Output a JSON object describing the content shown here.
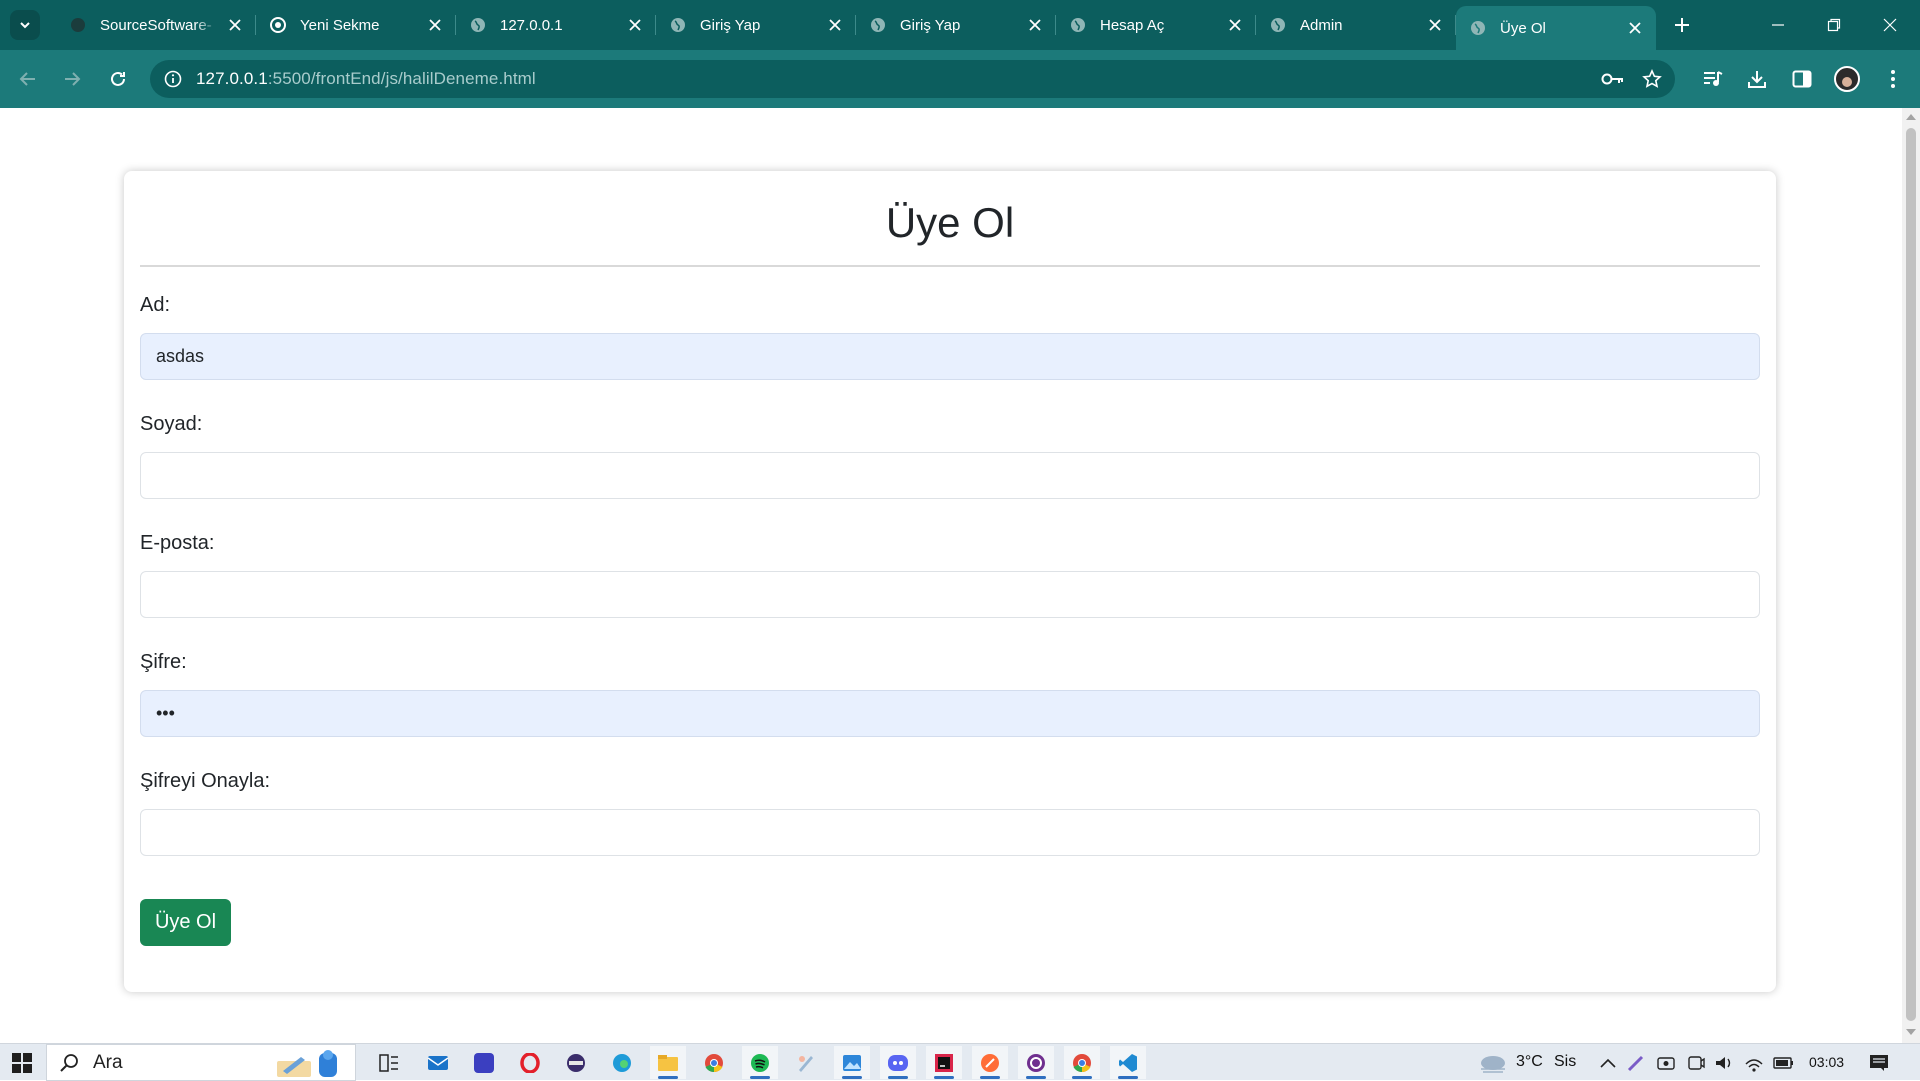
{
  "browser": {
    "tabs": [
      {
        "title": "SourceSoftware-",
        "favicon": "dark-circle-icon",
        "active": false
      },
      {
        "title": "Yeni Sekme",
        "favicon": "chrome-icon",
        "active": false
      },
      {
        "title": "127.0.0.1",
        "favicon": "globe-icon",
        "active": false
      },
      {
        "title": "Giriş Yap",
        "favicon": "globe-icon",
        "active": false
      },
      {
        "title": "Giriş Yap",
        "favicon": "globe-icon",
        "active": false
      },
      {
        "title": "Hesap Aç",
        "favicon": "globe-icon",
        "active": false
      },
      {
        "title": "Admin",
        "favicon": "globe-icon",
        "active": false
      },
      {
        "title": "Üye Ol",
        "favicon": "globe-icon",
        "active": true
      }
    ],
    "url": {
      "host": "127.0.0.1",
      "path": ":5500/frontEnd/js/halilDeneme.html"
    },
    "colors": {
      "frame": "#0c5e5e",
      "toolbar": "#1c7a7a"
    }
  },
  "page": {
    "title": "Üye Ol",
    "fields": [
      {
        "label": "Ad:",
        "value": "asdas",
        "type": "text",
        "autofilled": true
      },
      {
        "label": "Soyad:",
        "value": "",
        "type": "text",
        "autofilled": false
      },
      {
        "label": "E-posta:",
        "value": "",
        "type": "email",
        "autofilled": false
      },
      {
        "label": "Şifre:",
        "value": "123",
        "type": "password",
        "autofilled": true
      },
      {
        "label": "Şifreyi Onayla:",
        "value": "",
        "type": "password",
        "autofilled": false
      }
    ],
    "submit_label": "Üye Ol",
    "colors": {
      "submit": "#198754",
      "autofill": "#e8f0fe"
    }
  },
  "taskbar": {
    "search_text": "Ara",
    "weather": {
      "temp": "3°C",
      "condition": "Sis"
    },
    "clock": "03:03",
    "apps": [
      "task-view-icon",
      "mail-icon",
      "pen-app-icon",
      "opera-icon",
      "media-app-icon",
      "edge-icon",
      "file-explorer-icon",
      "chrome-icon",
      "spotify-icon",
      "paint-icon",
      "photos-icon",
      "discord-icon",
      "jetbrains-icon",
      "postman-icon",
      "obs-icon",
      "chrome-profile-icon",
      "vscode-icon"
    ]
  }
}
